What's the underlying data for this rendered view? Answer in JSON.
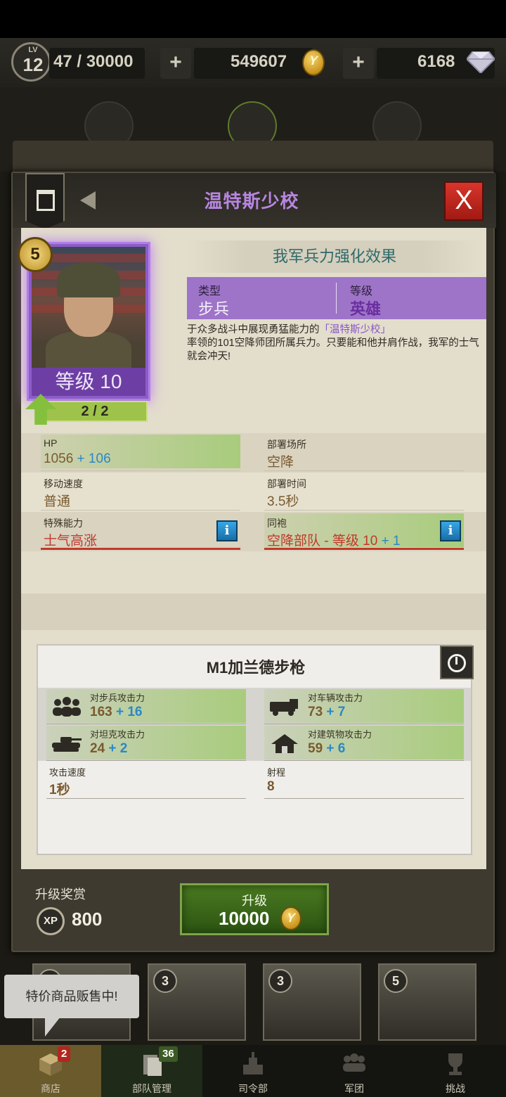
{
  "topbar": {
    "level_label": "LV",
    "level": "12",
    "xp": "47 / 30000",
    "gold": "549607",
    "gems": "6168",
    "plus": "+"
  },
  "modal": {
    "title": "温特斯少校",
    "close": "X",
    "hero": {
      "stars": "5",
      "level_text": "等级 10",
      "progress_text": "2 / 2",
      "progress": 1.0
    },
    "bonus_title": "我军兵力强化效果",
    "type_label": "类型",
    "type_value": "步兵",
    "grade_label": "等级",
    "grade_value": "英雄",
    "desc_pre": "于众多战斗中展现勇猛能力的",
    "desc_name": "「温特斯少校」",
    "desc_post": "率领的101空降师团所属兵力。只要能和他并肩作战，我军的士气就会冲天!",
    "stats": {
      "hp_label": "HP",
      "hp_base": "1056",
      "hp_plus": " + 106",
      "deploy_place_label": "部署场所",
      "deploy_place_value": "空降",
      "move_speed_label": "移动速度",
      "move_speed_value": "普通",
      "deploy_time_label": "部署时间",
      "deploy_time_value": "3.5秒",
      "special_label": "特殊能力",
      "special_value": "士气高涨",
      "comrade_label": "同袍",
      "comrade_value": "空降部队 - 等级 10",
      "comrade_plus": " + 1",
      "info": "i"
    },
    "weapon": {
      "name": "M1加兰德步枪",
      "inf_attack_label": "对步兵攻击力",
      "inf_attack_base": "163",
      "inf_attack_plus": " + 16",
      "veh_attack_label": "对车辆攻击力",
      "veh_attack_base": "73",
      "veh_attack_plus": " + 7",
      "tank_attack_label": "对坦克攻击力",
      "tank_attack_base": "24",
      "tank_attack_plus": " + 2",
      "bld_attack_label": "对建筑物攻击力",
      "bld_attack_base": "59",
      "bld_attack_plus": " + 6",
      "atk_speed_label": "攻击速度",
      "atk_speed_value": "1秒",
      "range_label": "射程",
      "range_value": "8"
    },
    "reward_label": "升级奖赏",
    "xp_badge": "XP",
    "xp_reward": "800",
    "upgrade_label": "升级",
    "upgrade_cost": "10000"
  },
  "cards": [
    "3",
    "3",
    "3",
    "5"
  ],
  "tooltip": "特价商品贩售中!",
  "nav": [
    {
      "label": "商店",
      "badge": "2"
    },
    {
      "label": "部队管理",
      "badge": "36"
    },
    {
      "label": "司令部",
      "badge": ""
    },
    {
      "label": "军团",
      "badge": ""
    },
    {
      "label": "挑战",
      "badge": ""
    }
  ],
  "colors": {
    "title_purple": "#b786e0",
    "close_red": "#c82b20",
    "upgrade_green": "#3d6a1a",
    "plus_blue": "#2a88c5"
  }
}
